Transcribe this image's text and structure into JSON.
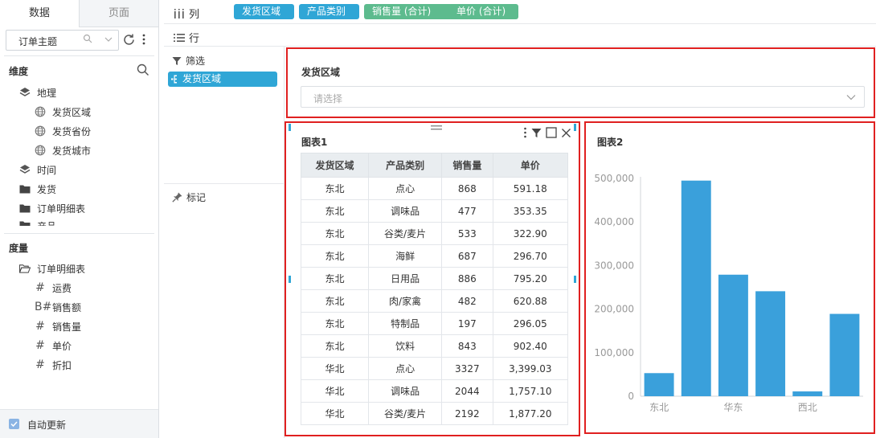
{
  "left_panel": {
    "tabs": [
      {
        "label": "数据",
        "active": true
      },
      {
        "label": "页面",
        "active": false
      }
    ],
    "theme_select": {
      "value": "订单主题"
    },
    "dimensions_title": "维度",
    "dimension_tree": [
      {
        "label": "地理",
        "icon": "layers-icon",
        "level": 0
      },
      {
        "label": "发货区域",
        "icon": "globe-icon",
        "level": 1
      },
      {
        "label": "发货省份",
        "icon": "globe-icon",
        "level": 1
      },
      {
        "label": "发货城市",
        "icon": "globe-icon",
        "level": 1
      },
      {
        "label": "时间",
        "icon": "layers-icon",
        "level": 0
      },
      {
        "label": "发货",
        "icon": "folder-icon",
        "level": 0
      },
      {
        "label": "订单明细表",
        "icon": "folder-icon",
        "level": 0
      },
      {
        "label": "产品",
        "icon": "folder-icon",
        "level": 0
      }
    ],
    "measures_title": "度量",
    "measure_tree": [
      {
        "label": "订单明细表",
        "icon": "folder-open-icon",
        "glyph": "",
        "level": 0
      },
      {
        "label": "运费",
        "icon": "hash-icon",
        "glyph": "#",
        "level": 1
      },
      {
        "label": "销售额",
        "icon": "calc-hash-icon",
        "glyph": "B#",
        "level": 1
      },
      {
        "label": "销售量",
        "icon": "hash-icon",
        "glyph": "#",
        "level": 1
      },
      {
        "label": "单价",
        "icon": "hash-icon",
        "glyph": "#",
        "level": 1
      },
      {
        "label": "折扣",
        "icon": "hash-icon",
        "glyph": "#",
        "level": 1
      }
    ],
    "auto_update": {
      "label": "自动更新",
      "checked": true
    }
  },
  "shelves": {
    "column_label": "列",
    "row_label": "行",
    "column_pills": [
      {
        "label": "发货区域",
        "kind": "dimension"
      },
      {
        "label": "产品类别",
        "kind": "dimension"
      },
      {
        "label": "销售量 (合计)",
        "kind": "measure"
      },
      {
        "label": "单价 (合计)",
        "kind": "measure"
      }
    ]
  },
  "filter_column": {
    "filter_label": "筛选",
    "filter_pill": "发货区域",
    "marks_label": "标记"
  },
  "filter_widget": {
    "title": "发货区域",
    "placeholder": "请选择"
  },
  "table_widget": {
    "title": "图表1",
    "columns": [
      "发货区域",
      "产品类别",
      "销售量",
      "单价"
    ],
    "rows": [
      [
        "东北",
        "点心",
        "868",
        "591.18"
      ],
      [
        "东北",
        "调味品",
        "477",
        "353.35"
      ],
      [
        "东北",
        "谷类/麦片",
        "533",
        "322.90"
      ],
      [
        "东北",
        "海鲜",
        "687",
        "296.70"
      ],
      [
        "东北",
        "日用品",
        "886",
        "795.20"
      ],
      [
        "东北",
        "肉/家禽",
        "482",
        "620.88"
      ],
      [
        "东北",
        "特制品",
        "197",
        "296.05"
      ],
      [
        "东北",
        "饮料",
        "843",
        "902.40"
      ],
      [
        "华北",
        "点心",
        "3327",
        "3,399.03"
      ],
      [
        "华北",
        "调味品",
        "2044",
        "1,757.10"
      ],
      [
        "华北",
        "谷类/麦片",
        "2192",
        "1,877.20"
      ]
    ]
  },
  "colors": {
    "dimension_pill": "#2fa6d6",
    "measure_pill": "#5dbb8e",
    "bar": "#3aa0db",
    "highlight_border": "#e02020"
  },
  "chart_data": {
    "type": "bar",
    "title": "图表2",
    "categories": [
      "东北",
      "",
      "华东",
      "",
      "西北",
      ""
    ],
    "values": [
      53000,
      495000,
      279000,
      241000,
      11000,
      189000
    ],
    "ylim": [
      0,
      500000
    ],
    "yticks": [
      0,
      100000,
      200000,
      300000,
      400000,
      500000
    ],
    "ytick_labels": [
      "0",
      "100,000",
      "200,000",
      "300,000",
      "400,000",
      "500,000"
    ],
    "grid": false
  }
}
